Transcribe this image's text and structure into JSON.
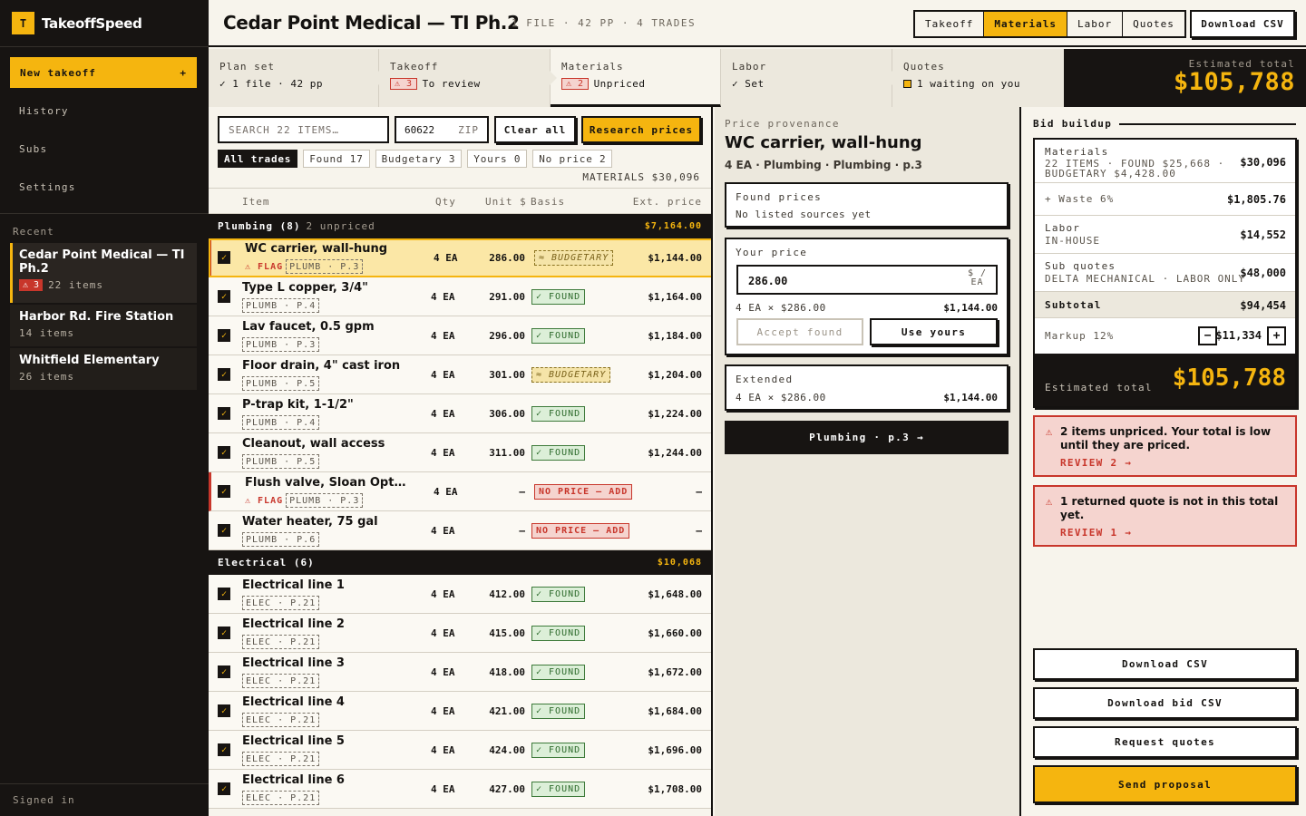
{
  "app": {
    "logo_letter": "T",
    "name": "TakeoffSpeed"
  },
  "sidebar": {
    "new_label": "New takeoff",
    "new_icon": "+",
    "nav": [
      "History",
      "Subs",
      "Settings"
    ],
    "recent_label": "Recent",
    "projects": [
      {
        "title": "Cedar Point Medical — TI Ph.2",
        "flags": "⚠ 3",
        "items": "22 items"
      },
      {
        "title": "Harbor Rd. Fire Station",
        "items": "14 items"
      },
      {
        "title": "Whitfield Elementary",
        "items": "26 items"
      }
    ],
    "signed_in": "Signed in"
  },
  "header": {
    "title": "Cedar Point Medical — TI Ph.2",
    "meta": "1 FILE · 42 PP · 4 TRADES",
    "tabs": [
      "Takeoff",
      "Materials",
      "Labor",
      "Quotes"
    ],
    "active_tab": "Materials",
    "download": "Download CSV"
  },
  "stepper": {
    "steps": [
      {
        "label": "Plan set",
        "status": "✓ 1 file · 42 pp"
      },
      {
        "label": "Takeoff",
        "flag": "⚠ 3",
        "status": "To review"
      },
      {
        "label": "Materials",
        "flag": "⚠ 2",
        "status": "Unpriced"
      },
      {
        "label": "Labor",
        "status": "✓ Set"
      },
      {
        "label": "Quotes",
        "status": "1 waiting on you"
      }
    ],
    "estimate_label": "Estimated total",
    "estimate_value": "$105,788"
  },
  "materials": {
    "search_placeholder": "SEARCH 22 ITEMS…",
    "zip_value": "60622",
    "zip_label": "ZIP",
    "clear_all": "Clear all",
    "research": "Research prices",
    "filters": [
      "All trades",
      "Found 17",
      "Budgetary 3",
      "Yours 0",
      "No price 2"
    ],
    "total_label": "MATERIALS $30,096",
    "columns": {
      "item": "Item",
      "qty": "Qty",
      "unit": "Unit $",
      "basis": "Basis",
      "ext": "Ext. price"
    },
    "groups": [
      {
        "name": "Plumbing (8)",
        "unpriced": "2 unpriced",
        "total": "$7,164.00",
        "rows": [
          {
            "name": "WC carrier, wall-hung",
            "flag": "⚠ FLAG",
            "src": "PLUMB · P.3",
            "qty": "4 EA",
            "unit": "286.00",
            "basis": "≈ BUDGETARY",
            "basis_type": "budg",
            "ext": "$1,144.00",
            "selected": true
          },
          {
            "name": "Type L copper, 3/4\"",
            "src": "PLUMB · P.4",
            "qty": "4 EA",
            "unit": "291.00",
            "basis": "✓ FOUND",
            "basis_type": "found",
            "ext": "$1,164.00"
          },
          {
            "name": "Lav faucet, 0.5 gpm",
            "src": "PLUMB · P.3",
            "qty": "4 EA",
            "unit": "296.00",
            "basis": "✓ FOUND",
            "basis_type": "found",
            "ext": "$1,184.00"
          },
          {
            "name": "Floor drain, 4\" cast iron",
            "src": "PLUMB · P.5",
            "qty": "4 EA",
            "unit": "301.00",
            "basis": "≈ BUDGETARY",
            "basis_type": "budg",
            "ext": "$1,204.00"
          },
          {
            "name": "P-trap kit, 1-1/2\"",
            "src": "PLUMB · P.4",
            "qty": "4 EA",
            "unit": "306.00",
            "basis": "✓ FOUND",
            "basis_type": "found",
            "ext": "$1,224.00"
          },
          {
            "name": "Cleanout, wall access",
            "src": "PLUMB · P.5",
            "qty": "4 EA",
            "unit": "311.00",
            "basis": "✓ FOUND",
            "basis_type": "found",
            "ext": "$1,244.00"
          },
          {
            "name": "Flush valve, Sloan Opt…",
            "flag": "⚠ FLAG",
            "src": "PLUMB · P.3",
            "qty": "4 EA",
            "unit": "—",
            "basis": "NO PRICE — ADD",
            "basis_type": "none",
            "ext": "—"
          },
          {
            "name": "Water heater, 75 gal",
            "src": "PLUMB · P.6",
            "qty": "4 EA",
            "unit": "—",
            "basis": "NO PRICE — ADD",
            "basis_type": "none",
            "ext": "—"
          }
        ]
      },
      {
        "name": "Electrical (6)",
        "unpriced": "",
        "total": "$10,068",
        "rows": [
          {
            "name": "Electrical line 1",
            "src": "ELEC · P.21",
            "qty": "4 EA",
            "unit": "412.00",
            "basis": "✓ FOUND",
            "basis_type": "found",
            "ext": "$1,648.00"
          },
          {
            "name": "Electrical line 2",
            "src": "ELEC · P.21",
            "qty": "4 EA",
            "unit": "415.00",
            "basis": "✓ FOUND",
            "basis_type": "found",
            "ext": "$1,660.00"
          },
          {
            "name": "Electrical line 3",
            "src": "ELEC · P.21",
            "qty": "4 EA",
            "unit": "418.00",
            "basis": "✓ FOUND",
            "basis_type": "found",
            "ext": "$1,672.00"
          },
          {
            "name": "Electrical line 4",
            "src": "ELEC · P.21",
            "qty": "4 EA",
            "unit": "421.00",
            "basis": "✓ FOUND",
            "basis_type": "found",
            "ext": "$1,684.00"
          },
          {
            "name": "Electrical line 5",
            "src": "ELEC · P.21",
            "qty": "4 EA",
            "unit": "424.00",
            "basis": "✓ FOUND",
            "basis_type": "found",
            "ext": "$1,696.00"
          },
          {
            "name": "Electrical line 6",
            "src": "ELEC · P.21",
            "qty": "4 EA",
            "unit": "427.00",
            "basis": "✓ FOUND",
            "basis_type": "found",
            "ext": "$1,708.00"
          }
        ]
      }
    ]
  },
  "provenance": {
    "label": "Price provenance",
    "title": "WC carrier, wall-hung",
    "subtitle": "4 EA · Plumbing · Plumbing · p.3",
    "found_label": "Found prices",
    "found_value": "No listed sources yet",
    "your_label": "Your price",
    "your_value": "286.00",
    "your_unit_top": "$ /",
    "your_unit_bottom": "EA",
    "calc": "4 EA × $286.00",
    "calc_value": "$1,144.00",
    "accept": "Accept found",
    "use_yours": "Use yours",
    "ext_label": "Extended",
    "ext_calc": "4 EA × $286.00",
    "ext_value": "$1,144.00",
    "goto": "Plumbing · p.3 →"
  },
  "bid": {
    "label": "Bid buildup",
    "materials_label": "Materials",
    "materials_sub1": "22 ITEMS · FOUND $25,668 ·",
    "materials_sub2": "BUDGETARY $4,428.00",
    "materials_value": "$30,096",
    "waste_label": "+ Waste 6%",
    "waste_value": "$1,805.76",
    "labor_label": "Labor",
    "labor_sub": "IN-HOUSE",
    "labor_value": "$14,552",
    "sub_label": "Sub quotes",
    "sub_sub": "DELTA MECHANICAL · LABOR ONLY",
    "sub_value": "$48,000",
    "subtotal_label": "Subtotal",
    "subtotal_value": "$94,454",
    "markup_label": "Markup 12%",
    "markup_value": "$11,334",
    "markup_minus": "−",
    "markup_plus": "+",
    "total_label": "Estimated total",
    "total_value": "$105,788",
    "alerts": [
      {
        "icon": "⚠",
        "text": "2 items unpriced. Your total is low until they are priced.",
        "action": "REVIEW 2 →"
      },
      {
        "icon": "⚠",
        "text": "1 returned quote is not in this total yet.",
        "action": "REVIEW 1 →"
      }
    ],
    "buttons": [
      "Download CSV",
      "Download bid CSV",
      "Request quotes"
    ],
    "send": "Send proposal"
  },
  "colors": {
    "accent": "#f5b50f",
    "dark": "#171412",
    "danger": "#c8362b",
    "found": "#2d6a2b",
    "paper": "#f7f4ec"
  }
}
